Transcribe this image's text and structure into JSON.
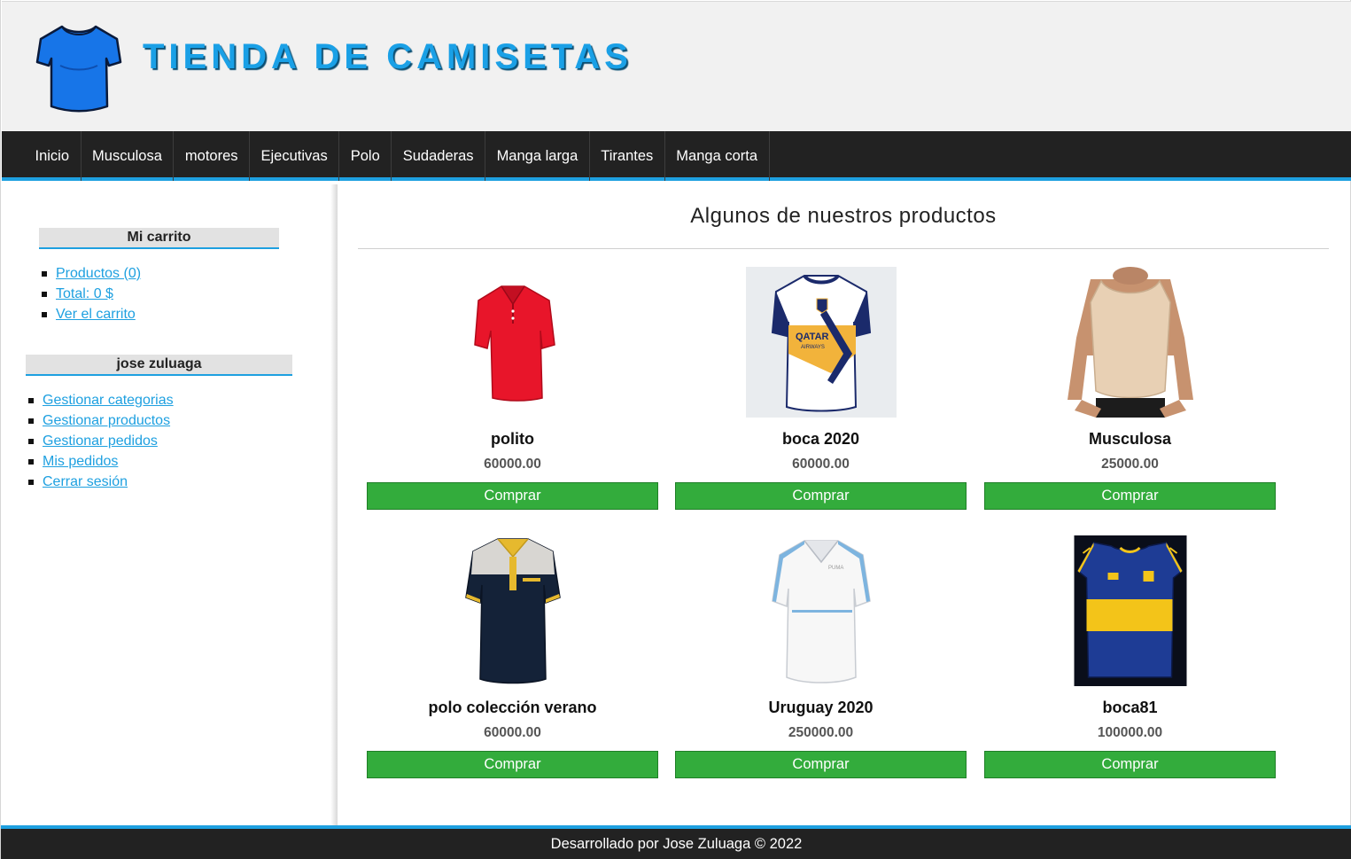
{
  "header": {
    "site_title": "TIENDA DE CAMISETAS",
    "logo_icon": "tshirt-icon",
    "colors": {
      "title": "#1aa0e6",
      "header_bg": "#f1f1f1"
    }
  },
  "nav": {
    "items": [
      "Inicio",
      "Musculosa",
      "motores",
      "Ejecutivas",
      "Polo",
      "Sudaderas",
      "Manga larga",
      "Tirantes",
      "Manga corta"
    ],
    "colors": {
      "bg": "#222222",
      "accent": "#1ea0e0"
    }
  },
  "sidebar": {
    "cart": {
      "title": "Mi carrito",
      "links": [
        "Productos (0)",
        "Total: 0 $",
        "Ver el carrito"
      ]
    },
    "user": {
      "title": "jose zuluaga",
      "links": [
        "Gestionar categorias",
        "Gestionar productos",
        "Gestionar pedidos",
        "Mis pedidos",
        "Cerrar sesión"
      ]
    }
  },
  "main": {
    "title": "Algunos de nuestros productos",
    "buy_label": "Comprar",
    "buy_color": "#33ac3c",
    "products": [
      {
        "name": "polito",
        "price": "60000.00",
        "image": "red-polo-shirt"
      },
      {
        "name": "boca 2020",
        "price": "60000.00",
        "image": "boca-2020-white-jersey"
      },
      {
        "name": "Musculosa",
        "price": "25000.00",
        "image": "beige-tank-top"
      },
      {
        "name": "polo colección verano",
        "price": "60000.00",
        "image": "navy-white-polo"
      },
      {
        "name": "Uruguay 2020",
        "price": "250000.00",
        "image": "uruguay-white-jersey"
      },
      {
        "name": "boca81",
        "price": "100000.00",
        "image": "boca-blue-yellow-jersey"
      }
    ]
  },
  "footer": {
    "text": "Desarrollado por Jose Zuluaga © 2022"
  }
}
